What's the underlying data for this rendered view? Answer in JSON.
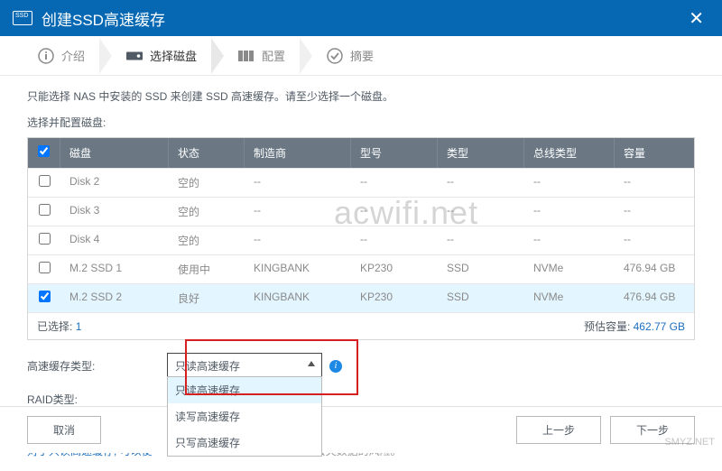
{
  "header": {
    "title": "创建SSD高速缓存"
  },
  "steps": [
    {
      "label": "介绍"
    },
    {
      "label": "选择磁盘"
    },
    {
      "label": "配置"
    },
    {
      "label": "摘要"
    }
  ],
  "desc": "只能选择 NAS 中安装的 SSD 来创建 SSD 高速缓存。请至少选择一个磁盘。",
  "section_label": "选择并配置磁盘:",
  "columns": {
    "disk": "磁盘",
    "status": "状态",
    "mfr": "制造商",
    "model": "型号",
    "type": "类型",
    "bustype": "总线类型",
    "cap": "容量"
  },
  "rows": [
    {
      "chk": false,
      "disk": "Disk 2",
      "status": "空的",
      "mfr": "--",
      "model": "--",
      "type": "--",
      "bustype": "--",
      "cap": "--"
    },
    {
      "chk": false,
      "disk": "Disk 3",
      "status": "空的",
      "mfr": "--",
      "model": "--",
      "type": "--",
      "bustype": "--",
      "cap": "--"
    },
    {
      "chk": false,
      "disk": "Disk 4",
      "status": "空的",
      "mfr": "--",
      "model": "--",
      "type": "--",
      "bustype": "--",
      "cap": "--"
    },
    {
      "chk": false,
      "disk": "M.2 SSD 1",
      "status": "使用中",
      "mfr": "KINGBANK",
      "model": "KP230",
      "type": "SSD",
      "bustype": "NVMe",
      "cap": "476.94 GB"
    },
    {
      "chk": true,
      "disk": "M.2 SSD 2",
      "status": "良好",
      "mfr": "KINGBANK",
      "model": "KP230",
      "type": "SSD",
      "bustype": "NVMe",
      "cap": "476.94 GB"
    }
  ],
  "footer_info": {
    "selected_label": "已选择:",
    "selected_count": "1",
    "est_label": "预估容量:",
    "est_value": "462.77 GB"
  },
  "form": {
    "cache_type_label": "高速缓存类型:",
    "raid_type_label": "RAID类型:",
    "selected_option": "只读高速缓存",
    "options": [
      "只读高速缓存",
      "读写高速缓存",
      "只写高速缓存"
    ]
  },
  "hint_prefix": "对于只读高速缓存, 可以使",
  "hint_suffix": "丢失数据的风险。",
  "buttons": {
    "cancel": "取消",
    "prev": "上一步",
    "next": "下一步"
  },
  "watermark": "acwifi.net",
  "watermark2": "SMYZ.NET"
}
